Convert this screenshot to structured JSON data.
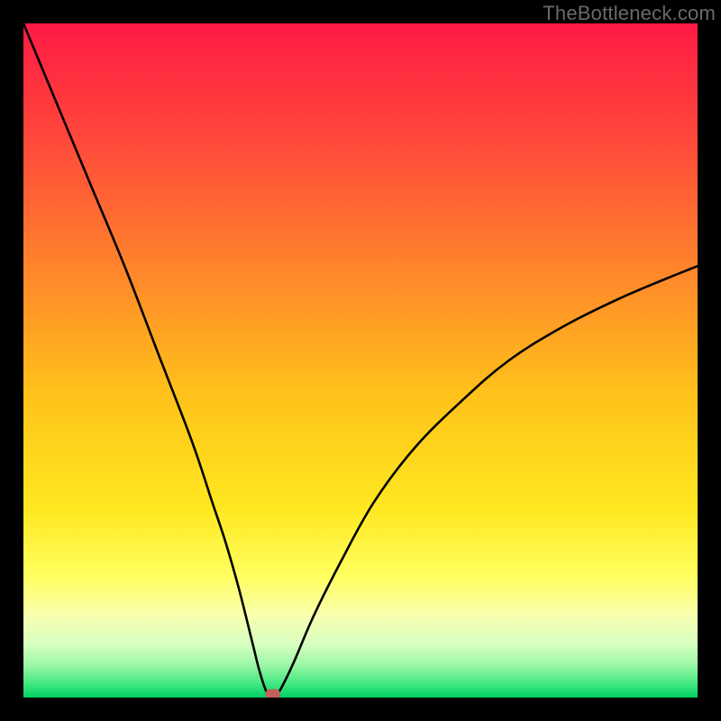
{
  "watermark": "TheBottleneck.com",
  "chart_data": {
    "type": "line",
    "title": "",
    "xlabel": "",
    "ylabel": "",
    "xlim": [
      0,
      100
    ],
    "ylim": [
      0,
      100
    ],
    "background": {
      "type": "vertical-gradient",
      "stops": [
        {
          "pct": 0,
          "color": "#ff1a44"
        },
        {
          "pct": 18,
          "color": "#ff4a3a"
        },
        {
          "pct": 38,
          "color": "#ff8a2a"
        },
        {
          "pct": 55,
          "color": "#ffc21a"
        },
        {
          "pct": 72,
          "color": "#ffe820"
        },
        {
          "pct": 82,
          "color": "#ffff60"
        },
        {
          "pct": 88,
          "color": "#f8ffb0"
        },
        {
          "pct": 92,
          "color": "#d8ffc0"
        },
        {
          "pct": 95,
          "color": "#a0f8a8"
        },
        {
          "pct": 98,
          "color": "#40e880"
        },
        {
          "pct": 100,
          "color": "#00d060"
        }
      ]
    },
    "series": [
      {
        "name": "bottleneck-curve",
        "color": "#000000",
        "x": [
          0,
          5,
          10,
          15,
          20,
          25,
          28,
          30,
          32,
          34,
          35,
          36,
          37,
          38,
          40,
          43,
          47,
          52,
          58,
          65,
          72,
          80,
          88,
          95,
          100
        ],
        "y": [
          100,
          88,
          76,
          64,
          51,
          38,
          29,
          23,
          16,
          8,
          4,
          1,
          0,
          1,
          5,
          12,
          20,
          29,
          37,
          44,
          50,
          55,
          59,
          62,
          64
        ]
      }
    ],
    "markers": [
      {
        "name": "optimal-point",
        "x": 37,
        "y": 0.5,
        "color": "#c0615a",
        "shape": "rounded-rect",
        "w": 2.2,
        "h": 1.5
      }
    ],
    "annotations": []
  },
  "colors": {
    "frame": "#000000",
    "curve": "#000000",
    "marker": "#c0615a",
    "watermark": "#6a6a6a"
  }
}
